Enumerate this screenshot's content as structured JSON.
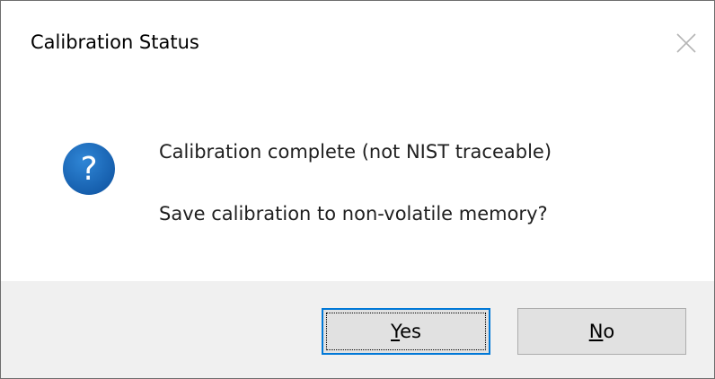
{
  "dialog": {
    "title": "Calibration Status",
    "message_line1": "Calibration complete (not NIST traceable)",
    "message_line2": "Save calibration to non-volatile memory?",
    "icon": "question-icon",
    "colors": {
      "icon_fill": "#1a64b5",
      "footer_background": "#f0f0f0",
      "default_button_border": "#0078d7"
    }
  },
  "buttons": {
    "yes": {
      "accel_char": "Y",
      "rest": "es",
      "label": "Yes"
    },
    "no": {
      "accel_char": "N",
      "rest": "o",
      "label": "No"
    }
  }
}
